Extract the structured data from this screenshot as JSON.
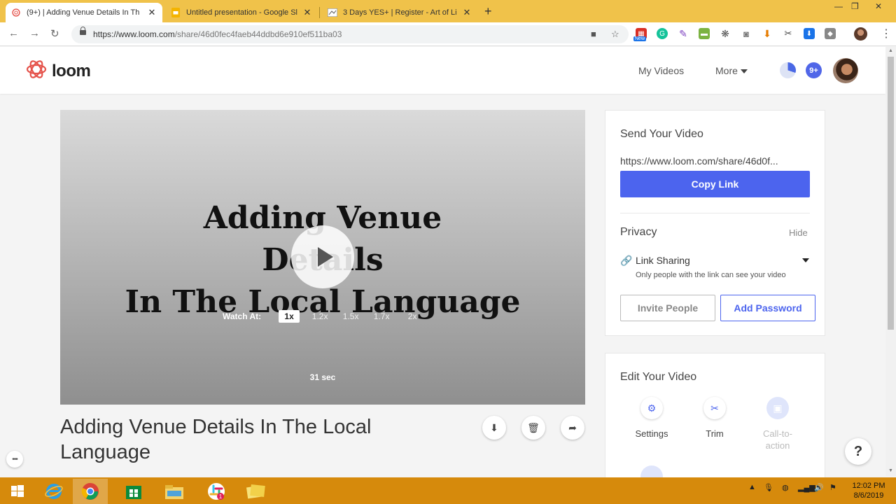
{
  "browser": {
    "tabs": [
      {
        "title": "(9+) | Adding Venue Details In Th",
        "active": true
      },
      {
        "title": "Untitled presentation - Google Sl",
        "active": false
      },
      {
        "title": "3 Days YES+ | Register - Art of Li",
        "active": false
      }
    ],
    "url_host": "https://www.loom.com",
    "url_path": "/share/46d0fec4faeb44ddbd6e910ef511ba03",
    "extension_new_badge": "New"
  },
  "header": {
    "logo_text": "loom",
    "my_videos": "My Videos",
    "more": "More",
    "notifications": "9+"
  },
  "video": {
    "title_lines": [
      "Adding Venue",
      "Details",
      "In The Local Language"
    ],
    "watch_at_label": "Watch At:",
    "speeds": [
      "1x",
      "1.2x",
      "1.5x",
      "1.7x",
      "2x"
    ],
    "selected_speed": "1x",
    "duration": "31 sec"
  },
  "page": {
    "title": "Adding Venue Details In The Local Language"
  },
  "send": {
    "heading": "Send Your Video",
    "share_url": "https://www.loom.com/share/46d0f...",
    "copy_button": "Copy Link"
  },
  "privacy": {
    "heading": "Privacy",
    "hide": "Hide",
    "sharing_mode": "Link Sharing",
    "description": "Only people with the link can see your video",
    "invite_button": "Invite People",
    "password_button": "Add Password"
  },
  "edit": {
    "heading": "Edit Your Video",
    "tools": [
      "Settings",
      "Trim",
      "Call-to-action"
    ]
  },
  "help": "?",
  "taskbar": {
    "time": "12:02 PM",
    "date": "8/6/2019"
  },
  "colors": {
    "accent": "#4c64ee",
    "chrome_frame": "#f0c24a",
    "taskbar": "#d68a0c",
    "loom_logo": "#e5524a"
  }
}
